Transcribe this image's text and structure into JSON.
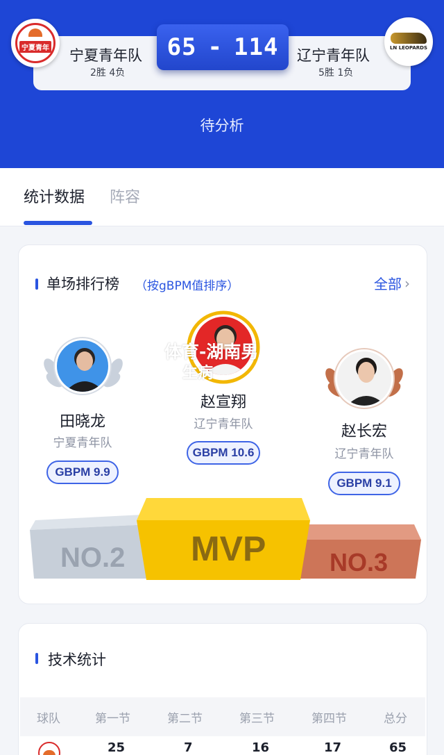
{
  "match": {
    "home_team": {
      "name": "宁夏青年队",
      "record": "2胜 4负",
      "logo_text": "宁夏青年"
    },
    "away_team": {
      "name": "辽宁青年队",
      "record": "5胜 1负",
      "logo_text": "LN LEOPARDS"
    },
    "home_score": "65",
    "separator": "-",
    "away_score": "114",
    "status": "待分析"
  },
  "tabs": [
    {
      "label": "统计数据",
      "active": true
    },
    {
      "label": "阵容",
      "active": false
    }
  ],
  "leaderboard": {
    "title": "单场排行榜",
    "subtitle": "（按gBPM值排序）",
    "all_link": "全部",
    "players": [
      {
        "rank": "NO.2",
        "name": "田晓龙",
        "team": "宁夏青年队",
        "gbpm": "GBPM 9.9"
      },
      {
        "rank": "MVP",
        "name": "赵宣翔",
        "team": "辽宁青年队",
        "gbpm": "GBPM 10.6"
      },
      {
        "rank": "NO.3",
        "name": "赵长宏",
        "team": "辽宁青年队",
        "gbpm": "GBPM 9.1"
      }
    ],
    "overlay_line1": "体育-湖南男",
    "overlay_line2": "生病"
  },
  "tech_stats": {
    "title": "技术统计",
    "columns": [
      "球队",
      "第一节",
      "第二节",
      "第三节",
      "第四节",
      "总分"
    ],
    "rows": [
      {
        "team_logo": "宁夏青年",
        "values": [
          "25",
          "7",
          "16",
          "17",
          "65"
        ]
      }
    ]
  },
  "colors": {
    "header_blue": "#1e46d6",
    "accent_blue": "#2a55e0",
    "mvp_gold": "#f6c200",
    "silver": "#c7cfd9",
    "bronze": "#cd7558"
  }
}
